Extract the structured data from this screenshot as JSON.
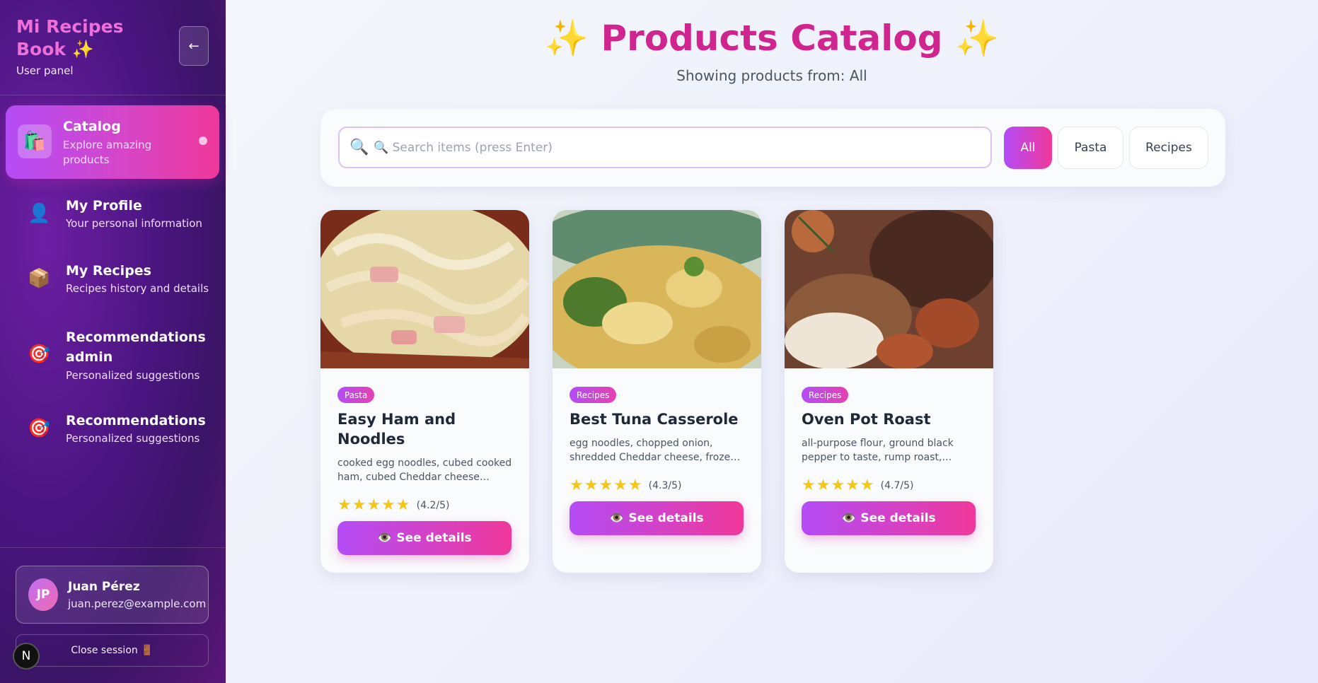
{
  "sidebar": {
    "brand_title": "Mi Recipes Book ✨",
    "brand_subtitle": "User panel",
    "collapse_label": "←",
    "items": [
      {
        "icon": "🛍️",
        "title": "Catalog",
        "desc": "Explore amazing products",
        "active": true
      },
      {
        "icon": "👤",
        "title": "My Profile",
        "desc": "Your personal information"
      },
      {
        "icon": "📦",
        "title": "My Recipes",
        "desc": "Recipes history and details"
      },
      {
        "icon": "🎯",
        "title": "Recommendations admin",
        "desc": "Personalized suggestions"
      },
      {
        "icon": "🎯",
        "title": "Recommendations",
        "desc": "Personalized suggestions"
      }
    ],
    "user": {
      "initials": "JP",
      "name": "Juan Pérez",
      "email": "juan.perez@example.com"
    },
    "close_label": "Close session 🚪",
    "n_badge": "N"
  },
  "main": {
    "title": "✨ Products Catalog ✨",
    "subtitle": "Showing products from: All",
    "search": {
      "icon": "🔍",
      "placeholder": "🔍 Search items (press Enter)",
      "value": ""
    },
    "filters": [
      {
        "label": "All",
        "active": true
      },
      {
        "label": "Pasta"
      },
      {
        "label": "Recipes"
      }
    ],
    "cards": [
      {
        "category": "Pasta",
        "title": "Easy Ham and Noodles",
        "desc": "cooked egg noodles, cubed cooked ham, cubed Cheddar cheese…",
        "stars": "★★★★★",
        "rating": "(4.2/5)",
        "button": "👁️ See details"
      },
      {
        "category": "Recipes",
        "title": "Best Tuna Casserole",
        "desc": "egg noodles, chopped onion, shredded Cheddar cheese, frozen peas…",
        "stars": "★★★★★",
        "rating": "(4.3/5)",
        "button": "👁️ See details"
      },
      {
        "category": "Recipes",
        "title": "Oven Pot Roast",
        "desc": "all-purpose flour, ground black pepper to taste, rump roast, carrots…",
        "stars": "★★★★★",
        "rating": "(4.7/5)",
        "button": "👁️ See details"
      }
    ]
  },
  "colors": {
    "accent_start": "#b44cf7",
    "accent_end": "#f0389a",
    "title": "#d0248f",
    "sidebar_bg": "#4a1580"
  }
}
